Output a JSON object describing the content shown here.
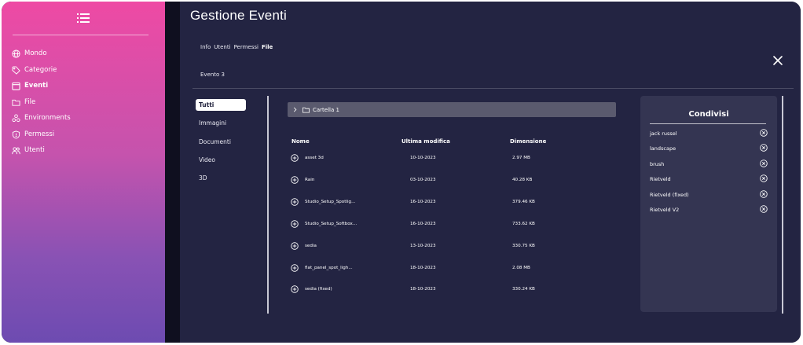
{
  "sidebar": {
    "items": [
      {
        "label": "Mondo",
        "icon": "globe-icon"
      },
      {
        "label": "Categorie",
        "icon": "tag-icon"
      },
      {
        "label": "Eventi",
        "icon": "calendar-icon",
        "active": true
      },
      {
        "label": "File",
        "icon": "folder-icon"
      },
      {
        "label": "Environments",
        "icon": "environments-icon"
      },
      {
        "label": "Permessi",
        "icon": "shield-icon"
      },
      {
        "label": "Utenti",
        "icon": "users-icon"
      }
    ]
  },
  "header": {
    "title": "Gestione Eventi",
    "tabs": [
      {
        "label": "Info"
      },
      {
        "label": "Utenti"
      },
      {
        "label": "Permessi"
      },
      {
        "label": "File",
        "active": true
      }
    ],
    "event_name": "Evento 3"
  },
  "filters": [
    "Tutti",
    "Immagini",
    "Documenti",
    "Video",
    "3D"
  ],
  "browser": {
    "folder": "Cartella 1",
    "columns": {
      "name": "Nome",
      "modified": "Ultima modifica",
      "size": "Dimensione"
    },
    "rows": [
      {
        "name": "asset 3d",
        "modified": "10-10-2023",
        "size": "2.97 MB"
      },
      {
        "name": "Rain",
        "modified": "03-10-2023",
        "size": "40.28 KB"
      },
      {
        "name": "Studio_Setup_Spotlig...",
        "modified": "16-10-2023",
        "size": "379.46 KB"
      },
      {
        "name": "Studio_Setup_Softbox...",
        "modified": "16-10-2023",
        "size": "733.62 KB"
      },
      {
        "name": "sedia",
        "modified": "13-10-2023",
        "size": "330.75 KB"
      },
      {
        "name": "flat_panel_spot_ligh...",
        "modified": "18-10-2023",
        "size": "2.08 MB"
      },
      {
        "name": "sedia (fixed)",
        "modified": "18-10-2023",
        "size": "330.24 KB"
      }
    ]
  },
  "shared": {
    "title": "Condivisi",
    "items": [
      "jack russel",
      "landscape",
      "brush",
      "Rietveld",
      "Rietveld (fixed)",
      "Rietveld V2"
    ]
  },
  "colors": {
    "sidebar_top": "#ee4aa4",
    "sidebar_bottom": "#6d4bb1",
    "main_bg": "#232442",
    "panel_bg": "#343552",
    "folder_row_bg": "#5a5a6e"
  }
}
